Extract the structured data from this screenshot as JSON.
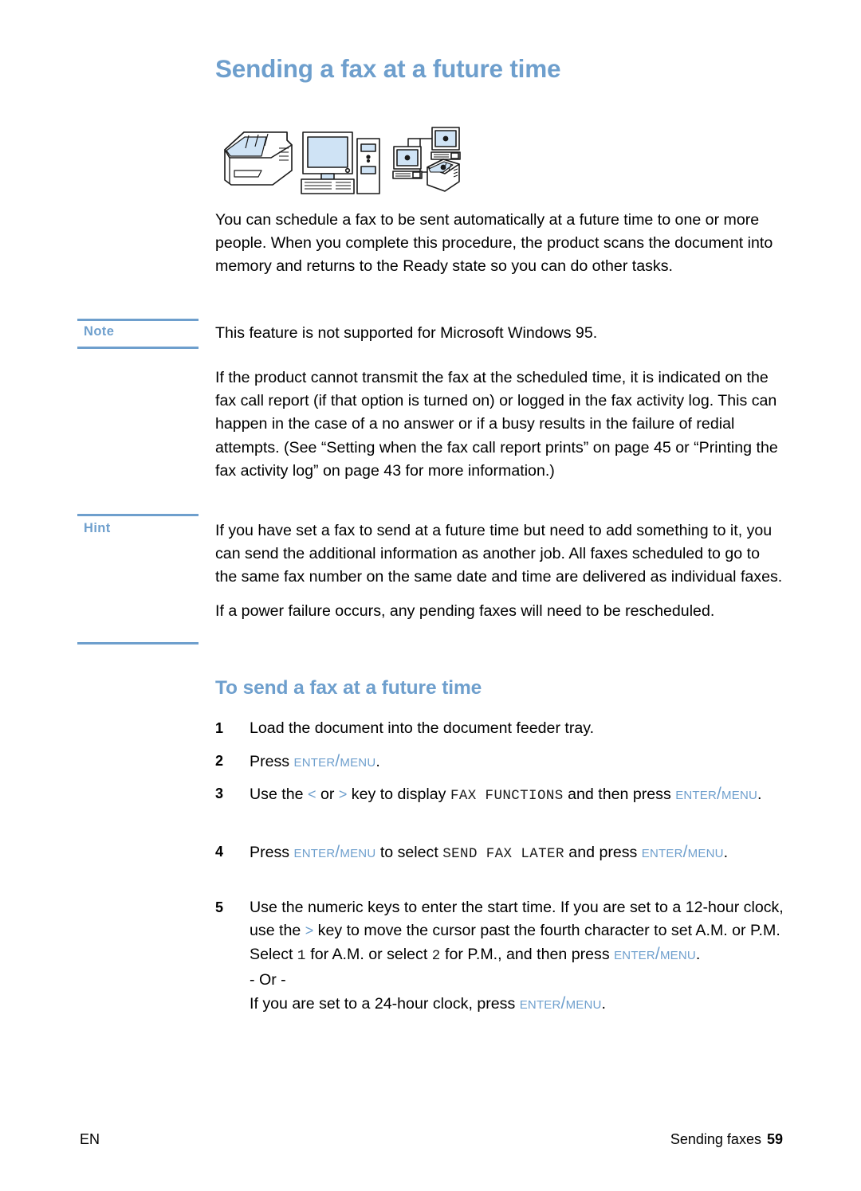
{
  "document": {
    "title": "Sending a fax at a future time",
    "accent_color": "#6e9fcd",
    "text_color": "#000000"
  },
  "illustration": {
    "name": "fax-computer-network-illustration",
    "items": [
      "printer-fax-icon",
      "desktop-computer-icon",
      "networked-computers-printer-icon"
    ]
  },
  "intro": {
    "paragraph": "You can schedule a fax to be sent automatically at a future time to one or more people. When you complete this procedure, the product scans the document into memory and returns to the Ready state so you can do other tasks."
  },
  "note": {
    "label": "Note",
    "paragraph": "This feature is not supported for Microsoft Windows 95."
  },
  "after_note": {
    "paragraph": "If the product cannot transmit the fax at the scheduled time, it is indicated on the fax call report (if that option is turned on) or logged in the fax activity log. This can happen in the case of a no answer or if a busy results in the failure of redial attempts. (See “Setting when the fax call report prints” on page 45 or “Printing the fax activity log” on page 43 for more information.)"
  },
  "hint": {
    "label": "Hint",
    "paragraph_1": "If you have set a fax to send at a future time but need to add something to it, you can send the additional information as another job. All faxes scheduled to go to the same fax number on the same date and time are delivered as individual faxes.",
    "paragraph_2": "If a power failure occurs, any pending faxes will need to be rescheduled."
  },
  "procedure": {
    "heading": "To send a fax at a future time",
    "steps": [
      {
        "number": "1",
        "parts": [
          {
            "type": "text",
            "value": "Load the document into the document feeder tray."
          }
        ]
      },
      {
        "number": "2",
        "parts": [
          {
            "type": "text",
            "value": "Press "
          },
          {
            "type": "key",
            "value": "Enter/Menu"
          },
          {
            "type": "text",
            "value": "."
          }
        ]
      },
      {
        "number": "3",
        "parts": [
          {
            "type": "text",
            "value": "Use the "
          },
          {
            "type": "arrowkey",
            "value": "<"
          },
          {
            "type": "text",
            "value": " or "
          },
          {
            "type": "arrowkey",
            "value": ">"
          },
          {
            "type": "text",
            "value": " key to display "
          },
          {
            "type": "lcd",
            "value": "FAX FUNCTIONS"
          },
          {
            "type": "text",
            "value": " and then press "
          },
          {
            "type": "key",
            "value": "Enter/Menu"
          },
          {
            "type": "text",
            "value": "."
          }
        ]
      },
      {
        "number": "4",
        "parts": [
          {
            "type": "text",
            "value": "Press "
          },
          {
            "type": "key",
            "value": "Enter/Menu"
          },
          {
            "type": "text",
            "value": " to select "
          },
          {
            "type": "lcd",
            "value": "SEND FAX LATER"
          },
          {
            "type": "text",
            "value": " and press "
          },
          {
            "type": "key",
            "value": "Enter/Menu"
          },
          {
            "type": "text",
            "value": "."
          }
        ]
      },
      {
        "number": "5",
        "parts": [
          {
            "type": "text",
            "value": "Use the numeric keys to enter the start time. If you are set to a 12-hour clock, use the "
          },
          {
            "type": "arrowkey",
            "value": ">"
          },
          {
            "type": "text",
            "value": " key to move the cursor past the fourth character to set A.M. or P.M. Select "
          },
          {
            "type": "lcd",
            "value": "1"
          },
          {
            "type": "text",
            "value": " for A.M. or select "
          },
          {
            "type": "lcd",
            "value": "2"
          },
          {
            "type": "text",
            "value": " for P.M., and then press "
          },
          {
            "type": "key",
            "value": "Enter/Menu"
          },
          {
            "type": "text",
            "value": "."
          },
          {
            "type": "break",
            "value": ""
          },
          {
            "type": "text",
            "value": "- Or -"
          },
          {
            "type": "break",
            "value": ""
          },
          {
            "type": "text",
            "value": "If you are set to a 24-hour clock, press "
          },
          {
            "type": "key",
            "value": "Enter/Menu"
          },
          {
            "type": "text",
            "value": "."
          }
        ]
      }
    ]
  },
  "footer": {
    "language": "EN",
    "section": "Sending faxes",
    "page_number": "59"
  }
}
